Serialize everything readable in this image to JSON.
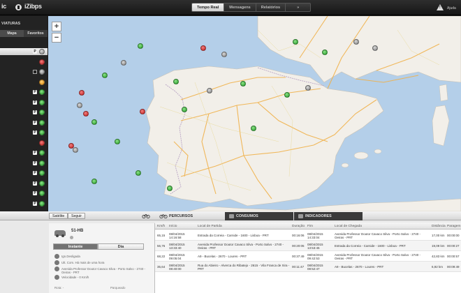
{
  "header": {
    "brand_left": "ic",
    "brand_right": "iZibps",
    "tabs": [
      {
        "label": "Tempo Real",
        "active": true
      },
      {
        "label": "Mensagens",
        "active": false
      },
      {
        "label": "Relatórios",
        "active": false
      },
      {
        "label": "»",
        "active": false
      }
    ],
    "help_label": "Ajuda"
  },
  "sidebar": {
    "title": "VIATURAS",
    "tabs": [
      {
        "label": "Mapa",
        "active": true
      },
      {
        "label": "Favoritos",
        "active": false
      }
    ],
    "vehicles": [
      {
        "badge": "P",
        "status": "grey",
        "selected": true
      },
      {
        "badge": "",
        "status": "red",
        "selected": false
      },
      {
        "badge": "square",
        "status": "grey",
        "selected": false
      },
      {
        "badge": "",
        "status": "orange",
        "selected": false
      },
      {
        "badge": "P",
        "status": "green",
        "selected": false
      },
      {
        "badge": "P",
        "status": "green",
        "selected": false
      },
      {
        "badge": "P",
        "status": "green",
        "selected": false
      },
      {
        "badge": "P",
        "status": "green",
        "selected": false
      },
      {
        "badge": "P",
        "status": "green",
        "selected": false
      },
      {
        "badge": "",
        "status": "red",
        "selected": false
      },
      {
        "badge": "P",
        "status": "green",
        "selected": false
      },
      {
        "badge": "P",
        "status": "green",
        "selected": false
      },
      {
        "badge": "P",
        "status": "green",
        "selected": false
      },
      {
        "badge": "P",
        "status": "green",
        "selected": false
      },
      {
        "badge": "P",
        "status": "green",
        "selected": false
      },
      {
        "badge": "P",
        "status": "green",
        "selected": false
      }
    ]
  },
  "map": {
    "zoom_in": "+",
    "zoom_out": "−",
    "markers": [
      {
        "status": "green",
        "lon": 3.0,
        "lat": 43.1
      },
      {
        "status": "green",
        "lon": 1.6,
        "lat": 43.6
      },
      {
        "status": "grey",
        "lon": 4.5,
        "lat": 43.6
      },
      {
        "status": "grey",
        "lon": 5.4,
        "lat": 43.3
      },
      {
        "status": "red",
        "lon": -2.8,
        "lat": 43.3
      },
      {
        "status": "grey",
        "lon": -1.8,
        "lat": 43.0
      },
      {
        "status": "green",
        "lon": -5.8,
        "lat": 43.4
      },
      {
        "status": "grey",
        "lon": -6.6,
        "lat": 42.6
      },
      {
        "status": "green",
        "lon": -7.5,
        "lat": 42.0
      },
      {
        "status": "green",
        "lon": -4.1,
        "lat": 41.7
      },
      {
        "status": "green",
        "lon": -3.7,
        "lat": 40.4
      },
      {
        "status": "grey",
        "lon": -2.5,
        "lat": 41.3
      },
      {
        "status": "green",
        "lon": -0.9,
        "lat": 41.6
      },
      {
        "status": "grey",
        "lon": 2.2,
        "lat": 41.4
      },
      {
        "status": "green",
        "lon": 1.2,
        "lat": 41.1
      },
      {
        "status": "green",
        "lon": -0.4,
        "lat": 39.5
      },
      {
        "status": "red",
        "lon": -5.7,
        "lat": 40.3
      },
      {
        "status": "red",
        "lon": -8.6,
        "lat": 41.2
      },
      {
        "status": "grey",
        "lon": -8.7,
        "lat": 40.6
      },
      {
        "status": "red",
        "lon": -8.4,
        "lat": 40.2
      },
      {
        "status": "green",
        "lon": -8.0,
        "lat": 39.8
      },
      {
        "status": "green",
        "lon": -6.9,
        "lat": 38.9
      },
      {
        "status": "red",
        "lon": -9.1,
        "lat": 38.7
      },
      {
        "status": "grey",
        "lon": -8.9,
        "lat": 38.5
      },
      {
        "status": "green",
        "lon": -5.9,
        "lat": 37.4
      },
      {
        "status": "green",
        "lon": -4.4,
        "lat": 36.7
      },
      {
        "status": "green",
        "lon": -8.0,
        "lat": 37.0
      }
    ]
  },
  "controls": {
    "satellite_label": "Satélite",
    "follow_label": "Seguir"
  },
  "panel_tabs": {
    "percursos": "PERCURSOS",
    "consumos": "CONSUMOS",
    "indicadores": "INDICADORES"
  },
  "vehicle_card": {
    "plate": "51-HB",
    "btn_instant": "Instante",
    "btn_day": "Dia",
    "info": [
      "Ign.Desligada",
      "Ult. Com. Há mais de uma hora",
      "Avenida Professor Doutor Cavaco Silva - Porto Salvo - 2740 -",
      "Oeiras - PRT",
      "Velocidade - 0 Km/h"
    ],
    "footer_left": "Rota: -",
    "footer_right": "Parqueado"
  },
  "trips": {
    "columns": [
      "Km/h",
      "Início",
      "Local de Partida",
      "Duração",
      "Fim",
      "Local de Chegada",
      "Distância",
      "Paragem"
    ],
    "rows": [
      {
        "kmh": "65,15",
        "start_date": "08/04/2015",
        "start_time": "14:16:58",
        "from": "Estrada da Correia - Carnide - 1600 - Lisboa - PRT",
        "from2": "",
        "duration": "00:16:06",
        "end_date": "08/04/2015",
        "end_time": "14:33:04",
        "to": "Avenida Professor Doutor Cavaco Silva - Porto Salvo - 2740 -",
        "to2": "Oeiras - PRT",
        "distance": "17,00 km",
        "stop": "00:00:00"
      },
      {
        "kmh": "56,76",
        "start_date": "08/04/2015",
        "start_time": "13:33:40",
        "from": "Avenida Professor Doutor Cavaco Silva - Porto Salvo - 2740 -",
        "from2": "Oeiras - PRT",
        "duration": "00:20:05",
        "end_date": "08/04/2015",
        "end_time": "13:53:45",
        "to": "Estrada da Correia - Carnide - 1600 - Lisboa - PRT",
        "to2": "",
        "distance": "19,09 km",
        "stop": "00:00:27"
      },
      {
        "kmh": "68,22",
        "start_date": "08/04/2015",
        "start_time": "09:05:04",
        "from": "A9 - Bucelas - 2670 - Loures - PRT",
        "from2": "",
        "duration": "00:37:49",
        "end_date": "08/04/2015",
        "end_time": "09:42:53",
        "to": "Avenida Professor Doutor Cavaco Silva - Porto Salvo - 2740 -",
        "to2": "Oeiras - PRT",
        "distance": "42,83 km",
        "stop": "00:00:57"
      },
      {
        "kmh": "35,64",
        "start_date": "08/04/2015",
        "start_time": "08:40:00",
        "from": "Rua do Abieiro - Alverca do Ribatejo - 2615 - Vila Franca de Xira -",
        "from2": "PRT",
        "duration": "00:11:47",
        "end_date": "08/04/2015",
        "end_time": "08:52:47",
        "to": "A9 - Bucelas - 2670 - Loures - PRT",
        "to2": "",
        "distance": "6,92 km",
        "stop": "00:09:49"
      }
    ]
  },
  "colors": {
    "topbar": "#1b1b1b",
    "map_sea": "#b4cfe9",
    "land": "#f2efe9",
    "status_green": "#1f9a22",
    "status_red": "#c11a1a",
    "status_orange": "#e18a06",
    "status_grey": "#7a7a7a"
  }
}
